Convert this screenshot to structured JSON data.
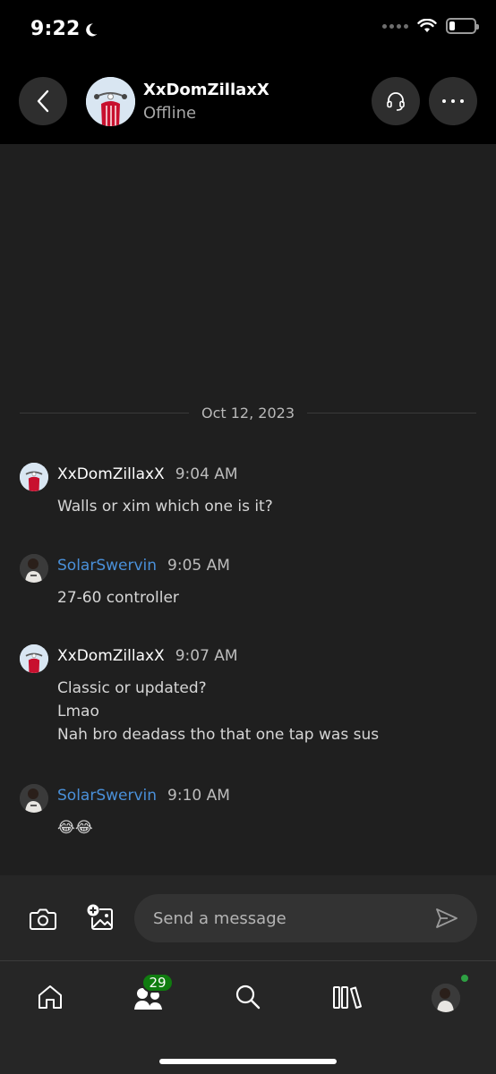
{
  "status_bar": {
    "time": "9:22"
  },
  "header": {
    "contact_name": "XxDomZillaxX",
    "presence": "Offline"
  },
  "conversation": {
    "date_divider": "Oct 12, 2023",
    "messages": [
      {
        "sender": "XxDomZillaxX",
        "time": "9:04 AM",
        "lines": [
          "Walls or xim which one is it?"
        ]
      },
      {
        "sender": "SolarSwervin",
        "time": "9:05 AM",
        "lines": [
          "27-60 controller"
        ]
      },
      {
        "sender": "XxDomZillaxX",
        "time": "9:07 AM",
        "lines": [
          "Classic or updated?",
          "Lmao",
          "Nah bro deadass tho that one tap was sus"
        ]
      },
      {
        "sender": "SolarSwervin",
        "time": "9:10 AM",
        "lines": [
          "😂😂"
        ]
      }
    ]
  },
  "composer": {
    "placeholder": "Send a message"
  },
  "tab_bar": {
    "social_badge_count": "29",
    "icons": [
      "home-icon",
      "people-icon",
      "search-icon",
      "library-icon",
      "profile-avatar"
    ]
  },
  "colors": {
    "self_name": "#4a90d9",
    "badge": "#107c10",
    "online": "#2ea043",
    "background": "#1f1f1f",
    "header": "#000000"
  }
}
